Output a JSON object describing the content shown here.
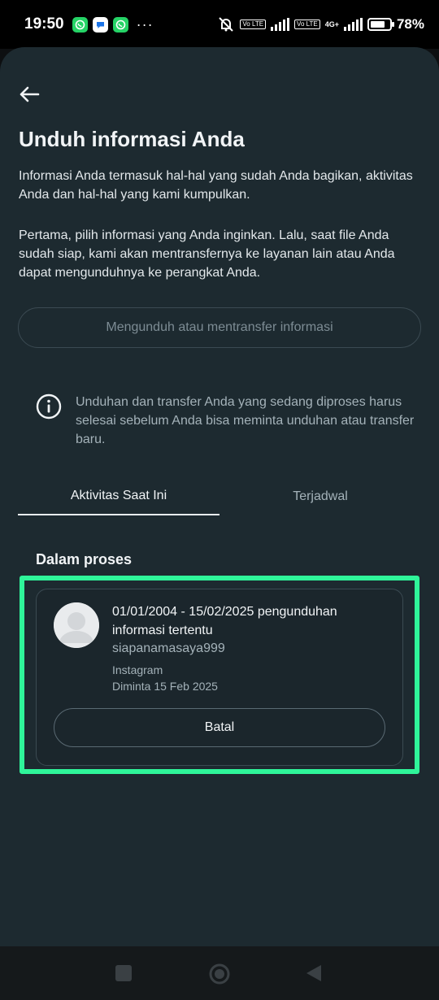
{
  "status_bar": {
    "time": "19:50",
    "notification_icons": [
      "whatsapp-icon",
      "messages-icon",
      "whatsapp-icon"
    ],
    "more": "···",
    "network_tag_1": "Vo LTE",
    "network_tag_2": "Vo LTE",
    "network_type": "4G+",
    "battery_level": 78,
    "battery_text": "78%"
  },
  "header": {
    "back_icon": "arrow-left-icon",
    "title": "Unduh informasi Anda"
  },
  "intro": {
    "paragraph_1": "Informasi Anda termasuk hal-hal yang sudah Anda bagikan, aktivitas Anda dan hal-hal yang kami kumpulkan.",
    "paragraph_2": "Pertama, pilih informasi yang Anda inginkan. Lalu, saat file Anda sudah siap, kami akan mentransfernya ke layanan lain atau Anda dapat mengunduhnya ke perangkat Anda."
  },
  "download_button": {
    "label": "Mengunduh atau mentransfer informasi",
    "enabled": false
  },
  "notice": {
    "icon": "info-icon",
    "text": "Unduhan dan transfer Anda yang sedang diproses harus selesai sebelum Anda bisa meminta unduhan atau transfer baru."
  },
  "tabs": [
    {
      "label": "Aktivitas Saat Ini",
      "active": true
    },
    {
      "label": "Terjadwal",
      "active": false
    }
  ],
  "in_progress": {
    "section_title": "Dalam proses",
    "request": {
      "title": "01/01/2004 - 15/02/2025 pengunduhan informasi tertentu",
      "username": "siapanamasaya999",
      "platform": "Instagram",
      "requested": "Diminta 15 Feb 2025",
      "cancel_label": "Batal"
    }
  },
  "colors": {
    "background": "#1d2a30",
    "highlight": "#2ff59a",
    "text_primary": "#f1f4f6",
    "text_secondary": "#a4b2b9"
  },
  "navigation": {
    "buttons": [
      "recent-apps-icon",
      "home-icon",
      "back-triangle-icon"
    ]
  }
}
